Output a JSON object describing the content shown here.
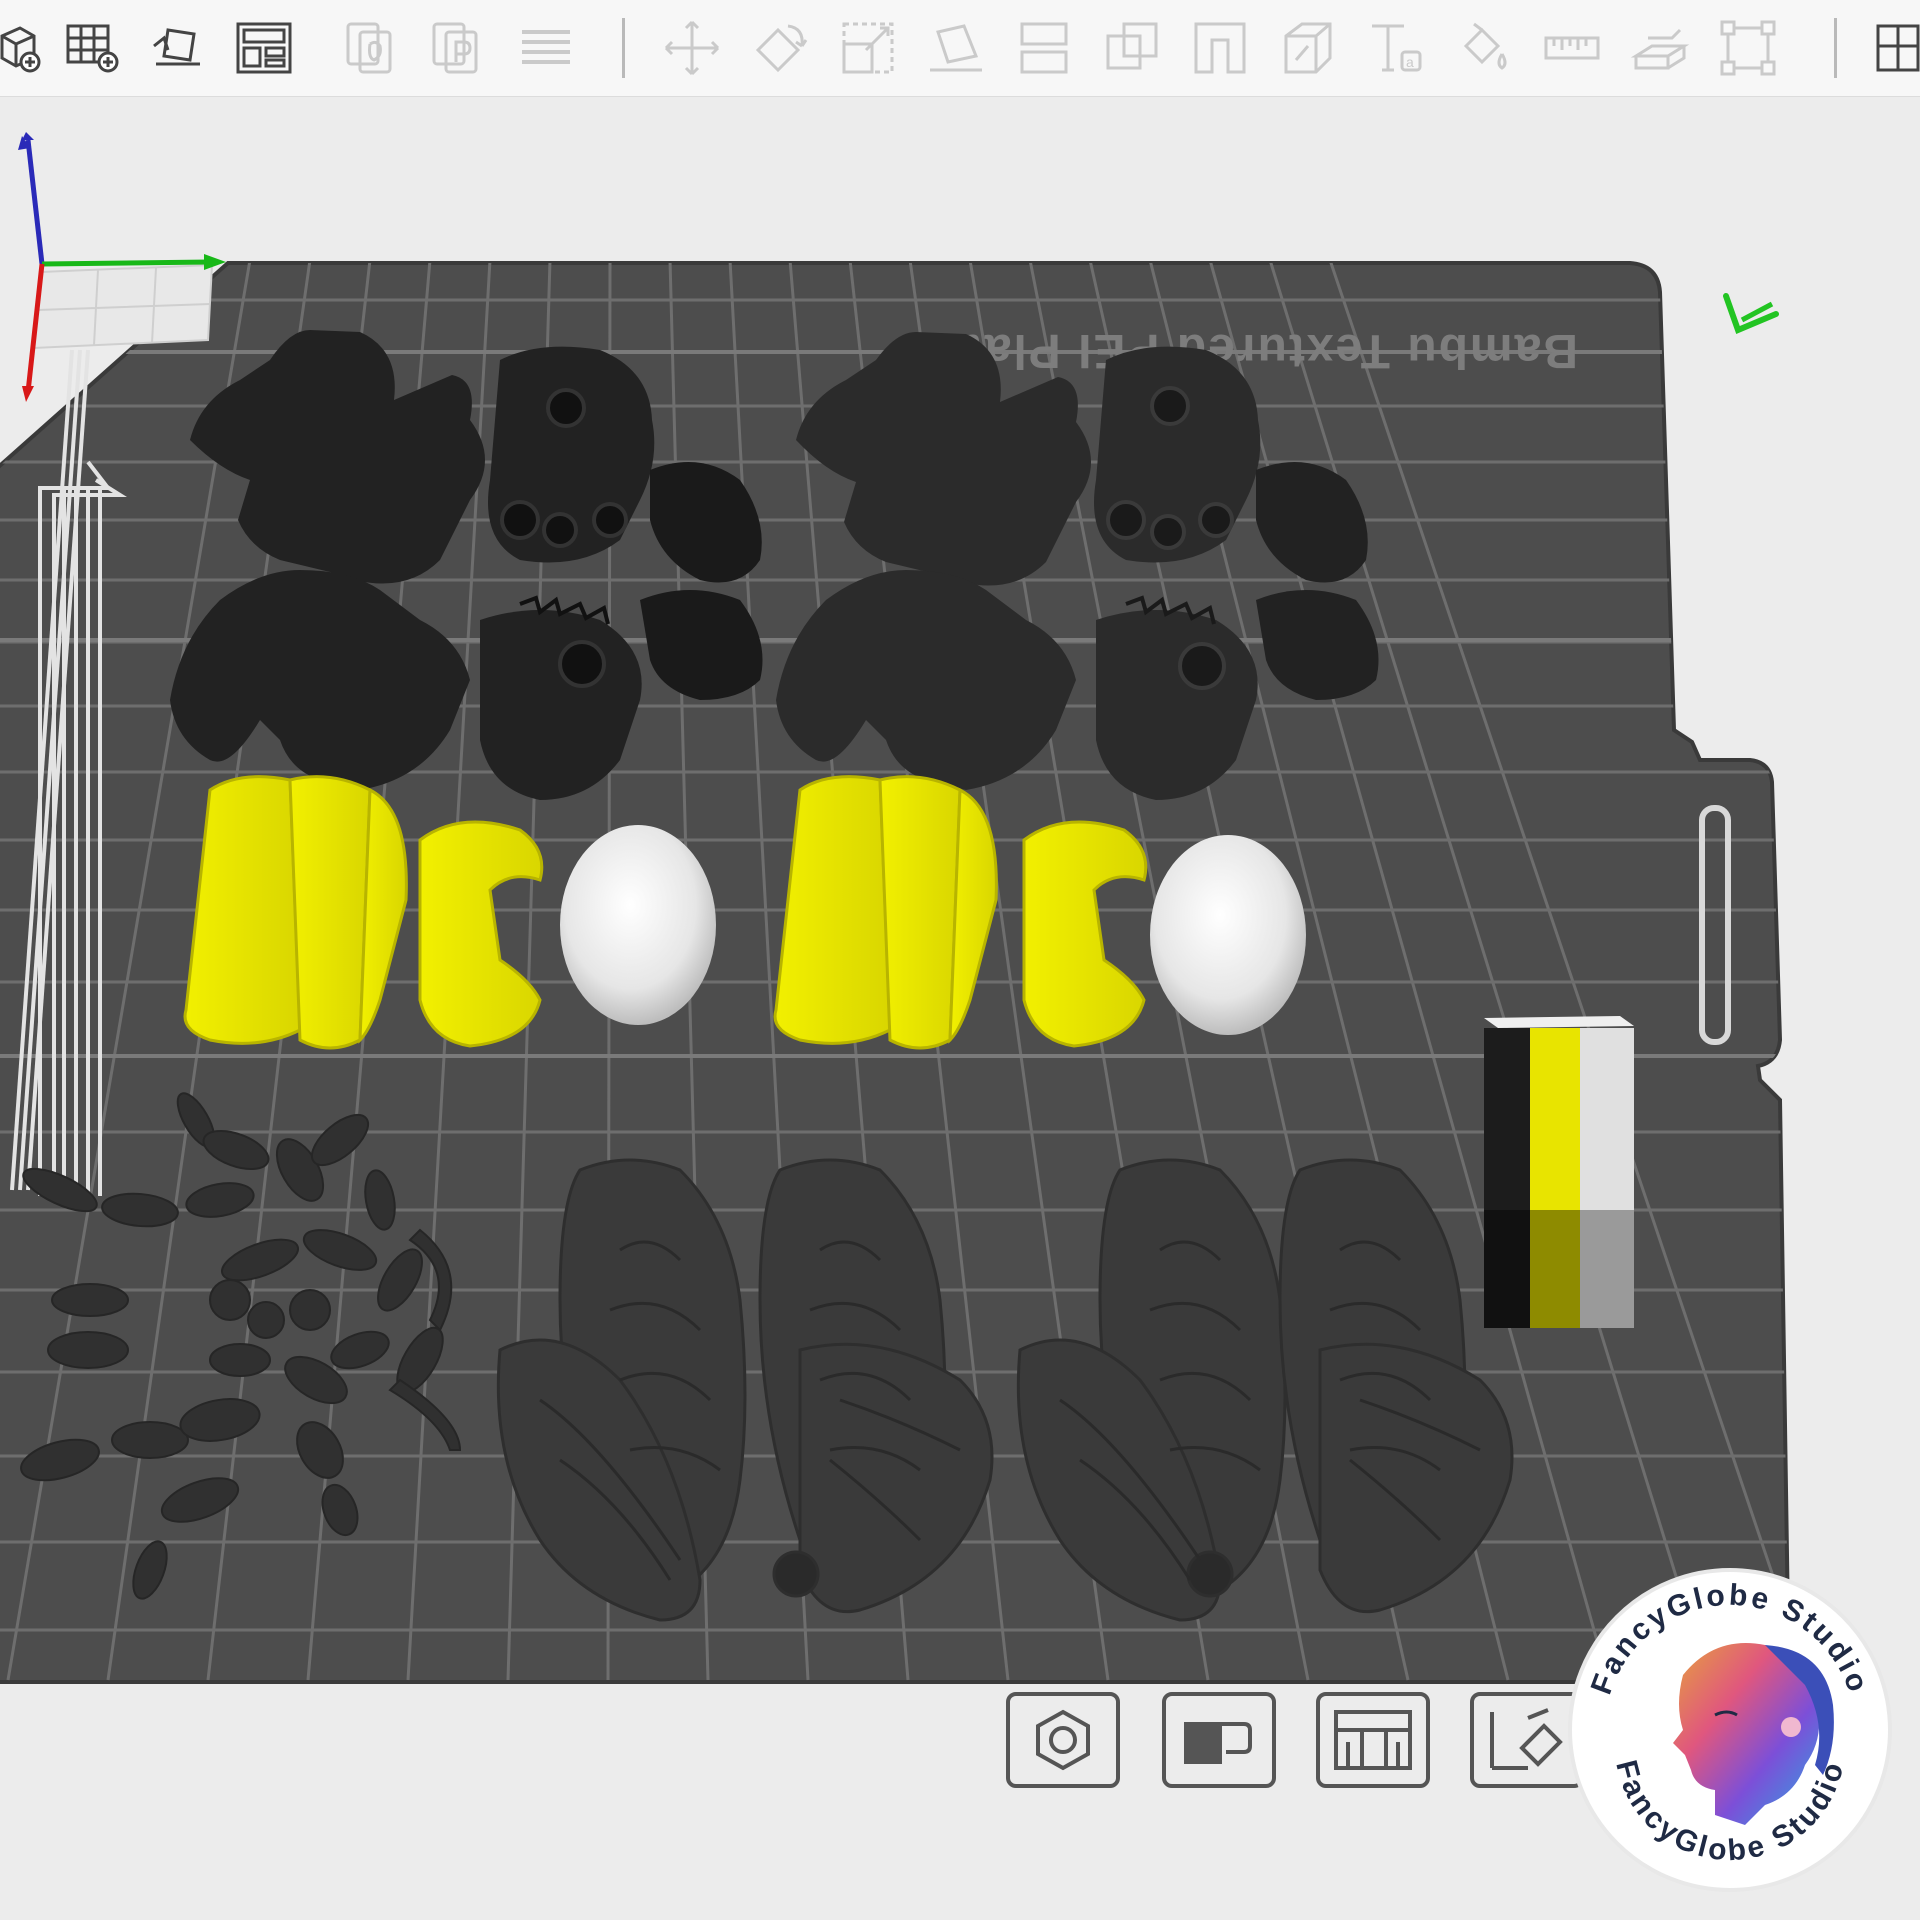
{
  "toolbar": {
    "icons": [
      "add-object-icon",
      "add-plate-icon",
      "auto-orient-icon",
      "arrange-icon",
      "copy-icon",
      "paste-icon",
      "list-icon",
      "move-icon",
      "rotate-icon",
      "scale-icon",
      "lay-on-face-icon",
      "cut-icon",
      "boolean-icon",
      "support-paint-icon",
      "split-icon",
      "text-icon",
      "color-paint-icon",
      "measure-icon",
      "assembly-icon",
      "fit-icon",
      "view-icon"
    ]
  },
  "plate": {
    "label": "Bambu Textured PEI Plate",
    "colors": {
      "surface": "#4d4d4d",
      "grid": "#6e6e6e",
      "background": "#ececec"
    }
  },
  "axes": {
    "x_color": "#18b818",
    "y_color": "#2a2ab8",
    "z_color": "#d81818"
  },
  "filament_colors": [
    "#1c1c1c",
    "#e8e400",
    "#e0e0e0"
  ],
  "bottom_toolbar": {
    "buttons": [
      "nut-icon",
      "wall-icon",
      "layout-icon",
      "edit-icon"
    ]
  },
  "watermark": {
    "text": "FancyGlobe Studio"
  }
}
